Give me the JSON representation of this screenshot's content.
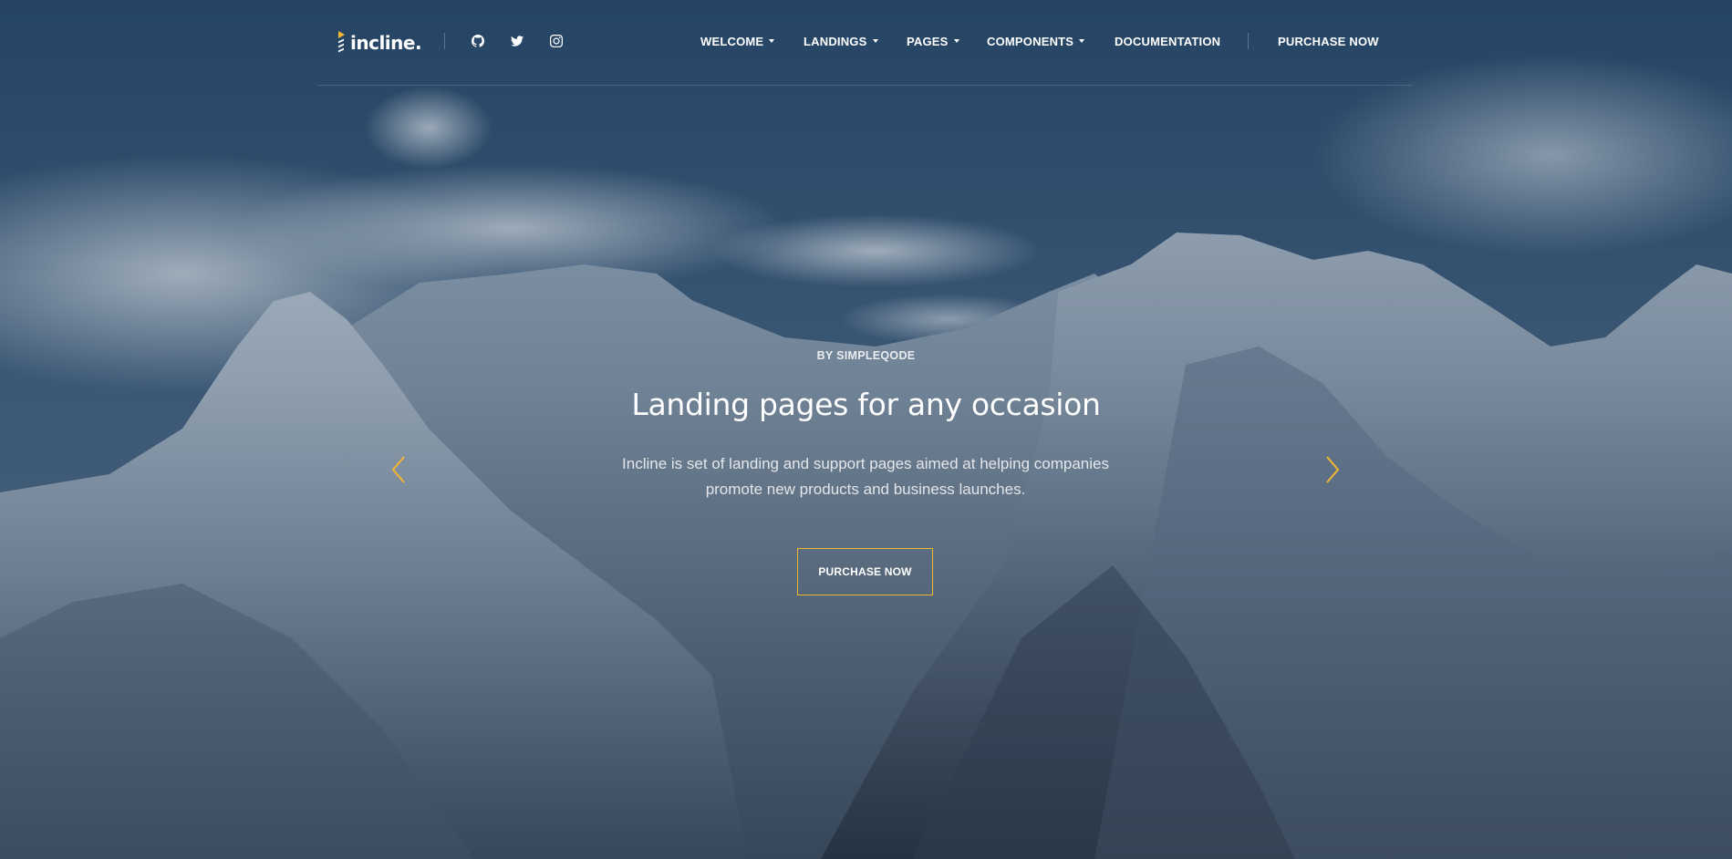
{
  "logo": {
    "text": "incline."
  },
  "social": [
    {
      "icon": "github-icon"
    },
    {
      "icon": "twitter-icon"
    },
    {
      "icon": "instagram-icon"
    }
  ],
  "nav": {
    "items": [
      {
        "label": "WELCOME",
        "dropdown": true
      },
      {
        "label": "LANDINGS",
        "dropdown": true
      },
      {
        "label": "PAGES",
        "dropdown": true
      },
      {
        "label": "COMPONENTS",
        "dropdown": true
      },
      {
        "label": "DOCUMENTATION",
        "dropdown": false
      }
    ],
    "purchase_label": "PURCHASE NOW"
  },
  "hero": {
    "eyebrow": "BY SIMPLEQODE",
    "title": "Landing pages for any occasion",
    "subtitle": "Incline is set of landing and support pages aimed at helping companies promote new products and business launches.",
    "cta_label": "PURCHASE NOW",
    "prev_icon": "chevron-left-icon",
    "next_icon": "chevron-right-icon"
  },
  "colors": {
    "accent": "#f2b632",
    "text": "#ffffff",
    "sky": "#3d5a75"
  }
}
